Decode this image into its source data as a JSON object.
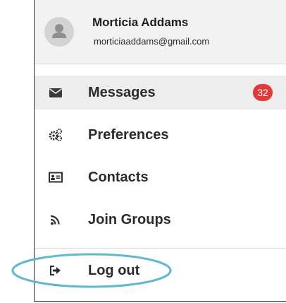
{
  "profile": {
    "name": "Morticia Addams",
    "email": "morticiaaddams@gmail.com",
    "avatar_icon": "user-silhouette-icon"
  },
  "menu": {
    "items": [
      {
        "label": "Messages",
        "icon": "envelope-icon",
        "badge": "32",
        "active": true
      },
      {
        "label": "Preferences",
        "icon": "gears-icon"
      },
      {
        "label": "Contacts",
        "icon": "contact-card-icon"
      },
      {
        "label": "Join Groups",
        "icon": "rss-feed-icon"
      },
      {
        "label": "Log out",
        "icon": "sign-out-icon",
        "highlighted": true
      }
    ]
  },
  "colors": {
    "badge": "#e23a3a",
    "highlight_ellipse": "#5fb8cf",
    "profile_background": "#f2f2f2"
  }
}
